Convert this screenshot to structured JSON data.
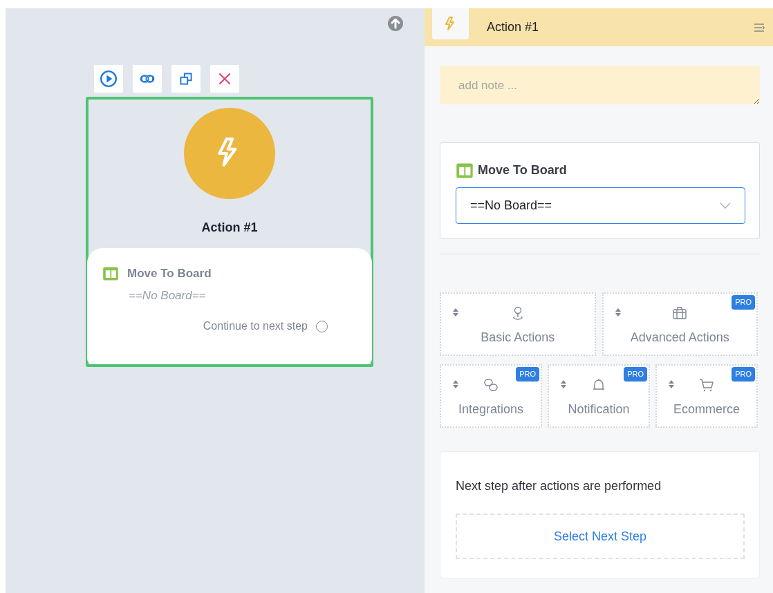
{
  "canvas": {
    "node": {
      "title": "Action #1",
      "action": {
        "label": "Move To Board",
        "value": "==No Board=="
      },
      "continue_label": "Continue to next step",
      "continue_checked": false
    }
  },
  "panel": {
    "header": {
      "title": "Action #1"
    },
    "note": {
      "placeholder": "add note ..."
    },
    "board": {
      "label": "Move To Board",
      "value": "==No Board=="
    },
    "categories": [
      {
        "label": "Basic Actions"
      },
      {
        "label": "Advanced Actions",
        "badge": "PRO"
      },
      {
        "label": "Integrations",
        "badge": "PRO"
      },
      {
        "label": "Notification",
        "badge": "PRO"
      },
      {
        "label": "Ecommerce",
        "badge": "PRO"
      }
    ],
    "next_step": {
      "label": "Next step after actions are performed",
      "button": "Select Next Step"
    }
  }
}
